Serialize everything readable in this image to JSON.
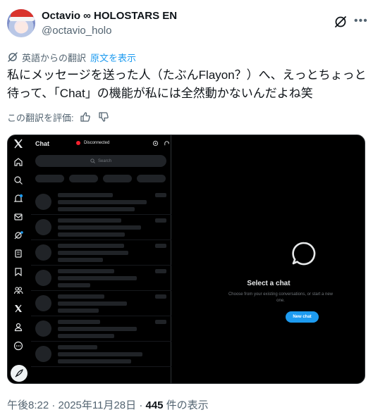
{
  "author": {
    "name": "Octavio ∞ HOLOSTARS EN",
    "handle": "@octavio_holo"
  },
  "translation": {
    "label": "英語からの翻訳",
    "show_original": "原文を表示"
  },
  "tweet_text": "私にメッセージを送った人（たぶんFlayon？）へ、えっとちょっと待って、「Chat」の機能が私には全然動かないんだよね笑",
  "rate_translation": "この翻訳を評価:",
  "screenshot": {
    "chat_title": "Chat",
    "status": "Disconnected",
    "search_placeholder": "Search",
    "select_title": "Select a chat",
    "select_sub": "Choose from your existing conversations, or start a new one.",
    "new_chat": "New chat"
  },
  "footer": {
    "time": "午後8:22 · 2025年11月28日 · ",
    "views_count": "445",
    "views_label": " 件の表示"
  },
  "colors": {
    "accent": "#1d9bf0",
    "secondary_text": "#536471",
    "status_red": "#f4212e"
  }
}
